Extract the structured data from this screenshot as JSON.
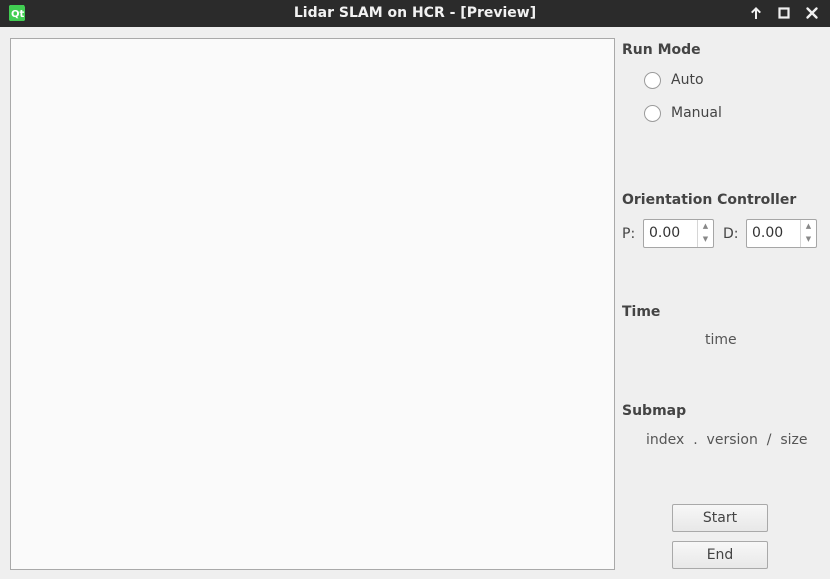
{
  "window": {
    "title": "Lidar SLAM on HCR - [Preview]"
  },
  "icons": {
    "app": "qt-app-icon",
    "keep_above": "arrow-up-icon",
    "maximize": "maximize-icon",
    "close": "close-icon",
    "spin_up": "triangle-up-icon",
    "spin_down": "triangle-down-icon"
  },
  "glyphs": {
    "spin_up": "▲",
    "spin_down": "▼"
  },
  "run_mode": {
    "title": "Run Mode",
    "options": [
      {
        "label": "Auto",
        "checked": false
      },
      {
        "label": "Manual",
        "checked": false
      }
    ]
  },
  "orientation": {
    "title": "Orientation Controller",
    "p_label": "P:",
    "p_value": "0.00",
    "d_label": "D:",
    "d_value": "0.00"
  },
  "time": {
    "title": "Time",
    "value": "time"
  },
  "submap": {
    "title": "Submap",
    "value": "index  .  version  /  size"
  },
  "buttons": {
    "start": "Start",
    "end": "End"
  },
  "colors": {
    "titlebar": "#2b2b2b",
    "canvas": "#fafafa",
    "window": "#efefef"
  }
}
